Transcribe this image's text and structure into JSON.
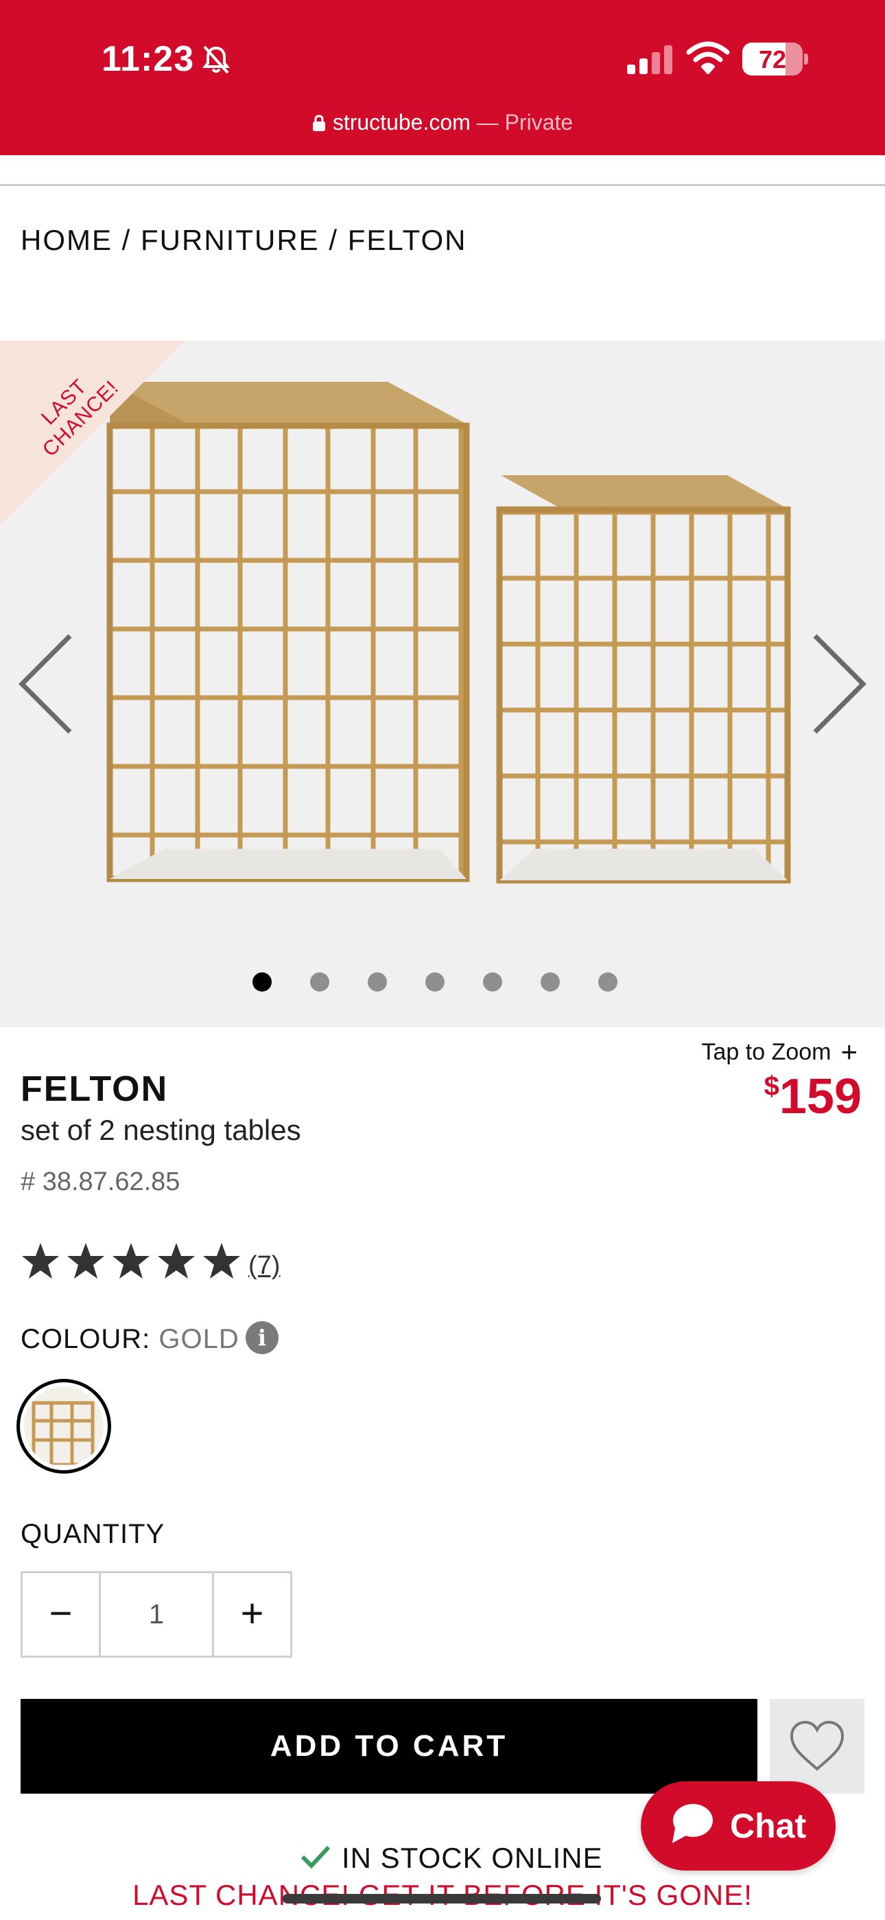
{
  "status_bar": {
    "time": "11:23",
    "battery_level": "72",
    "battery_fraction": 0.72
  },
  "address_bar": {
    "domain": "structube.com",
    "mode": " — Private"
  },
  "breadcrumb": [
    {
      "label": "HOME"
    },
    {
      "label": "FURNITURE"
    },
    {
      "label": "FELTON"
    }
  ],
  "breadcrumb_separator": "/",
  "gallery": {
    "badge_line1": "LAST",
    "badge_line2": "CHANCE!",
    "slide_count": 7,
    "active_slide": 1
  },
  "product": {
    "zoom_label": "Tap to Zoom",
    "zoom_symbol": "+",
    "name": "FELTON",
    "description": "set of 2 nesting tables",
    "sku": "# 38.87.62.85",
    "price_currency": "$",
    "price_amount": "159",
    "rating": 5,
    "reviews": "(7)",
    "colour_label": "COLOUR:",
    "colour_value": "GOLD",
    "info_glyph": "i"
  },
  "quantity": {
    "label": "QUANTITY",
    "minus": "−",
    "value": "1",
    "plus": "+"
  },
  "actions": {
    "add_to_cart": "ADD TO CART"
  },
  "stock": {
    "status": "IN STOCK ONLINE",
    "notice": "LAST CHANCE! GET IT BEFORE IT'S GONE!"
  },
  "chat": {
    "label": "Chat"
  },
  "colors": {
    "brand_red": "#d20b2b",
    "black": "#000000",
    "gold": "#c9a05b",
    "stock_green": "#3a9b5f"
  },
  "icons": [
    "bell-slash-icon",
    "signal-icon",
    "wifi-icon",
    "battery-icon",
    "lock-icon",
    "chevron-left-icon",
    "chevron-right-icon",
    "star-icon",
    "info-icon",
    "heart-icon",
    "checkmark-icon",
    "chat-bubble-icon"
  ]
}
